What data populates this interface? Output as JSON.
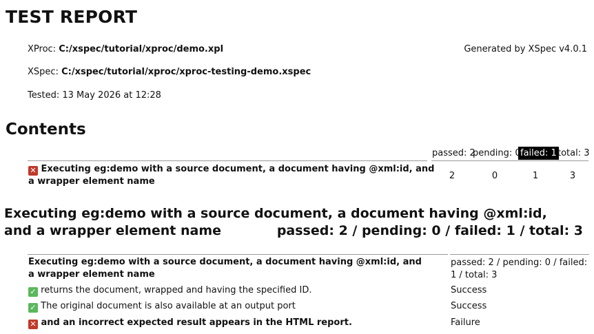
{
  "report": {
    "title": "TEST REPORT",
    "xproc_label": "XProc:",
    "xproc_path": "C:/xspec/tutorial/xproc/demo.xpl",
    "xspec_label": "XSpec:",
    "xspec_path": "C:/xspec/tutorial/xproc/xproc-testing-demo.xspec",
    "tested": "Tested: 13 May 2026 at 12:28",
    "generated_by": "Generated by XSpec v4.0.1"
  },
  "contents": {
    "heading": "Contents",
    "summary": {
      "passed": "passed: 2",
      "pending": "pending: 0",
      "failed": "failed: 1",
      "total": "total: 3"
    },
    "rows": [
      {
        "status": "failure",
        "label": "Executing eg:demo with a source document, a document having @xml:id, and a wrapper element name",
        "passed": "2",
        "pending": "0",
        "failed": "1",
        "total": "3"
      }
    ]
  },
  "scenario": {
    "heading": "Executing eg:demo with a source document, a document having @xml:id, and a wrapper element name",
    "totals": "passed: 2 / pending: 0 / failed: 1 / total: 3",
    "table_header": "Executing eg:demo with a source document, a document having @xml:id, and a wrapper element name",
    "table_header_totals": "passed: 2 / pending: 0 / failed: 1 / total: 3",
    "tests": [
      {
        "status": "success",
        "label": "returns the document, wrapped and having the specified ID.",
        "result": "Success"
      },
      {
        "status": "success",
        "label": "The original document is also available at an output port",
        "result": "Success"
      },
      {
        "status": "failure",
        "label": "and an incorrect expected result appears in the HTML report.",
        "result": "Failure"
      }
    ]
  },
  "colors": {
    "failure_icon": "#c0392b",
    "success_icon": "#5cb85c",
    "failed_highlight": "#000000"
  }
}
